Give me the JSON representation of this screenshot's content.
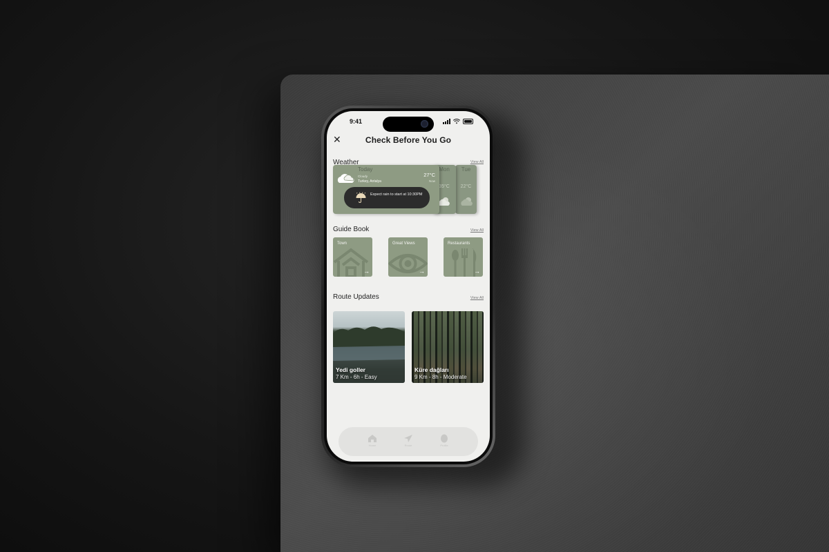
{
  "status_bar": {
    "time": "9:41"
  },
  "header": {
    "title": "Check Before You Go"
  },
  "weather": {
    "section_title": "Weather",
    "view_all": "View All",
    "today": {
      "label": "Today",
      "condition": "Cloudy",
      "location": "Turkey, Antalya",
      "temp": "27°C",
      "time_label": "Now",
      "alert": "Expect rain to start at 10:30PM"
    },
    "days": [
      {
        "name": "Mon",
        "temp": "35°C"
      },
      {
        "name": "Tue",
        "temp": "22°C"
      }
    ]
  },
  "guide": {
    "section_title": "Guide Book",
    "view_all": "View All",
    "cards": [
      {
        "label": "Town",
        "icon": "house-icon"
      },
      {
        "label": "Great Views",
        "icon": "eye-icon"
      },
      {
        "label": "Restaurants",
        "icon": "utensils-icon"
      }
    ]
  },
  "routes": {
    "section_title": "Route Updates",
    "view_all": "View All",
    "items": [
      {
        "name": "Yedi goller",
        "meta": "7 Km - 6h - Easy"
      },
      {
        "name": "Küre dağları",
        "meta": "9 Km - 8h - Moderate"
      }
    ]
  },
  "tabbar": {
    "items": [
      {
        "icon": "home-icon",
        "label": "Home"
      },
      {
        "icon": "navigation-icon",
        "label": "Route"
      },
      {
        "icon": "profile-icon",
        "label": "Profile"
      }
    ]
  },
  "colors": {
    "accent_green": "#8e9b83",
    "pill_dark": "#2c2c2c",
    "screen_bg": "#f0f0ee"
  }
}
